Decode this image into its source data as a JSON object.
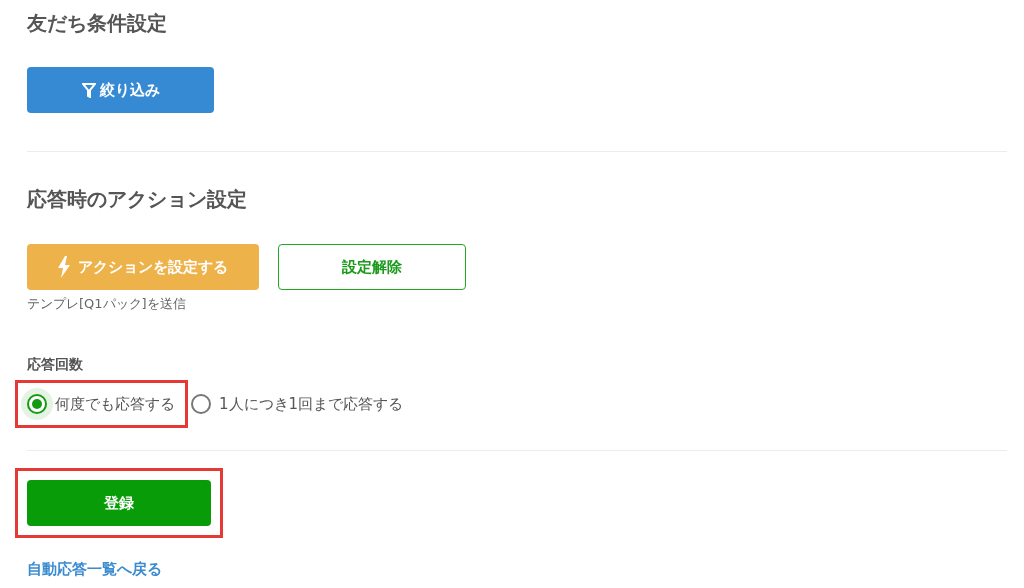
{
  "friend_filter": {
    "heading": "友だち条件設定",
    "filter_button": "絞り込み"
  },
  "action_settings": {
    "heading": "応答時のアクション設定",
    "set_action_button": "アクションを設定する",
    "clear_button": "設定解除",
    "current_action": "テンプレ[Q1パック]を送信"
  },
  "response_count": {
    "label": "応答回数",
    "options": [
      {
        "label": "何度でも応答する",
        "selected": true,
        "highlighted": true
      },
      {
        "label": "1人につき1回まで応答する",
        "selected": false,
        "highlighted": false
      }
    ]
  },
  "register_button": {
    "label": "登録",
    "highlighted": true
  },
  "back_link": "自動応答一覧へ戻る"
}
